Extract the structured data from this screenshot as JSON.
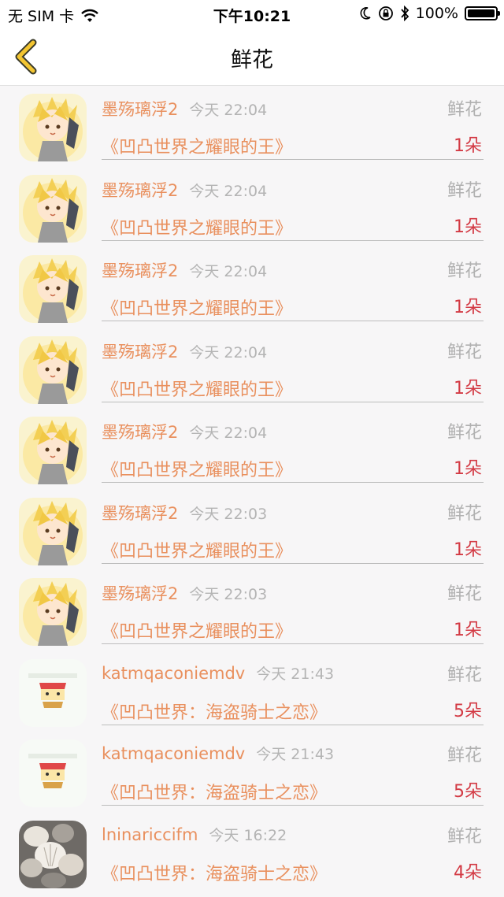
{
  "status_bar": {
    "carrier": "无 SIM 卡",
    "time": "下午10:21",
    "battery": "100%"
  },
  "nav": {
    "title": "鲜花"
  },
  "colors": {
    "name": "#e9905e",
    "count": "#d33a44",
    "muted": "#b0b0b0"
  },
  "rows": [
    {
      "name": "墨殇璃浮2",
      "time": "今天 22:04",
      "type": "鲜花",
      "book": "《凹凸世界之耀眼的王》",
      "count": "1朵",
      "avatar": "anime-avatar"
    },
    {
      "name": "墨殇璃浮2",
      "time": "今天 22:04",
      "type": "鲜花",
      "book": "《凹凸世界之耀眼的王》",
      "count": "1朵",
      "avatar": "anime-avatar"
    },
    {
      "name": "墨殇璃浮2",
      "time": "今天 22:04",
      "type": "鲜花",
      "book": "《凹凸世界之耀眼的王》",
      "count": "1朵",
      "avatar": "anime-avatar"
    },
    {
      "name": "墨殇璃浮2",
      "time": "今天 22:04",
      "type": "鲜花",
      "book": "《凹凸世界之耀眼的王》",
      "count": "1朵",
      "avatar": "anime-avatar"
    },
    {
      "name": "墨殇璃浮2",
      "time": "今天 22:04",
      "type": "鲜花",
      "book": "《凹凸世界之耀眼的王》",
      "count": "1朵",
      "avatar": "anime-avatar"
    },
    {
      "name": "墨殇璃浮2",
      "time": "今天 22:03",
      "type": "鲜花",
      "book": "《凹凸世界之耀眼的王》",
      "count": "1朵",
      "avatar": "anime-avatar"
    },
    {
      "name": "墨殇璃浮2",
      "time": "今天 22:03",
      "type": "鲜花",
      "book": "《凹凸世界之耀眼的王》",
      "count": "1朵",
      "avatar": "anime-avatar"
    },
    {
      "name": "katmqaconiemdv",
      "time": "今天 21:43",
      "type": "鲜花",
      "book": "《凹凸世界：海盗骑士之恋》",
      "count": "5朵",
      "avatar": "sticker-avatar"
    },
    {
      "name": "katmqaconiemdv",
      "time": "今天 21:43",
      "type": "鲜花",
      "book": "《凹凸世界：海盗骑士之恋》",
      "count": "5朵",
      "avatar": "sticker-avatar"
    },
    {
      "name": "lninariccifm",
      "time": "今天 16:22",
      "type": "鲜花",
      "book": "《凹凸世界：海盗骑士之恋》",
      "count": "4朵",
      "avatar": "shells-avatar"
    }
  ]
}
